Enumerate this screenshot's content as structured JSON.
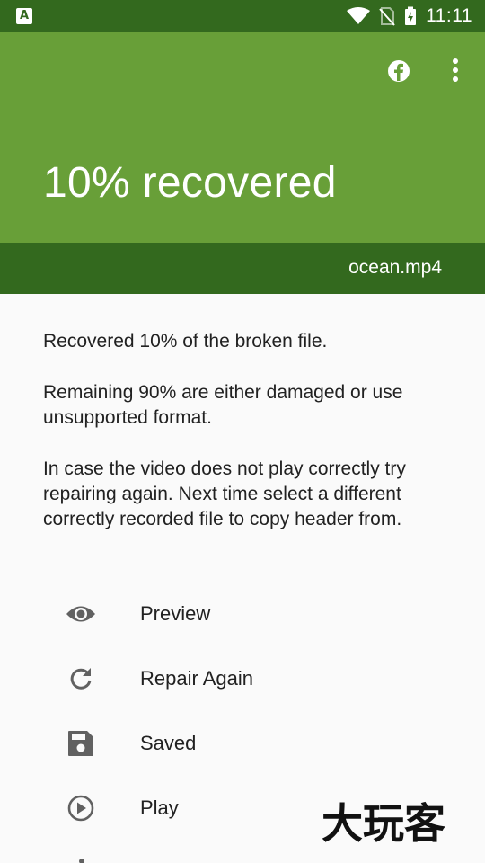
{
  "status_bar": {
    "notification_icon": "app-notification-icon",
    "notification_glyph": "A",
    "time": "11:11",
    "icons": [
      "wifi-icon",
      "no-sim-icon",
      "battery-charging-icon"
    ]
  },
  "app_bar": {
    "title": "10% recovered",
    "filename": "ocean.mp4",
    "actions": [
      "facebook-icon",
      "more-vert-icon"
    ],
    "colors": {
      "primary": "#689f38",
      "dark": "#33691e"
    }
  },
  "content": {
    "paragraphs": [
      "Recovered 10% of the broken file.",
      "Remaining 90% are either damaged or use unsupported format.",
      "In case the video does not play correctly try repairing again. Next time select a different correctly recorded file to copy header from."
    ]
  },
  "actions": [
    {
      "label": "Preview",
      "icon": "eye-icon"
    },
    {
      "label": "Repair Again",
      "icon": "refresh-icon"
    },
    {
      "label": "Saved",
      "icon": "save-icon"
    },
    {
      "label": "Play",
      "icon": "play-circle-icon"
    }
  ],
  "watermark": {
    "text": "大玩客"
  }
}
